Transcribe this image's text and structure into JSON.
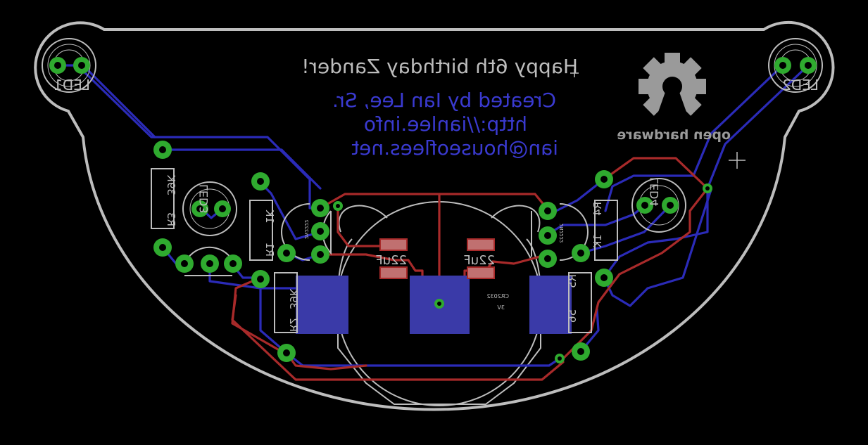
{
  "colors": {
    "background": "#000000",
    "board_outline": "#bdbdbd",
    "bottom_copper": "#2b2bb8",
    "top_copper": "#a82a2a",
    "pad": "#2faa2f",
    "bottom_text": "#3a3ad0",
    "silkscreen": "#bdbdbd"
  },
  "texts": {
    "greeting": "Happy 6th birthday Zander!",
    "credit": "Created by Ian Lee, Sr.",
    "website": "http://ianlee.info",
    "email": "ian@houseoflees.net",
    "logo_caption": "open hardware"
  },
  "component_labels": {
    "led1": "LED1",
    "led2": "LED2",
    "led3": "LED3",
    "led4": "LED4",
    "r1": "R1",
    "r1_value": "1K",
    "r2": "R2",
    "r2_value": "39K",
    "r3": "R3",
    "r3_value": "39K",
    "r4": "R4",
    "r4_value": "1K",
    "r5": "R5",
    "r5_value": "56",
    "c1_value": "22uF",
    "c2_value": "22uF",
    "q_left": "2N2222",
    "q_right": "2N2222",
    "cr2032": "CR2032",
    "battery_voltage": "3V"
  },
  "icons": [
    "open-hardware-gear-icon"
  ]
}
